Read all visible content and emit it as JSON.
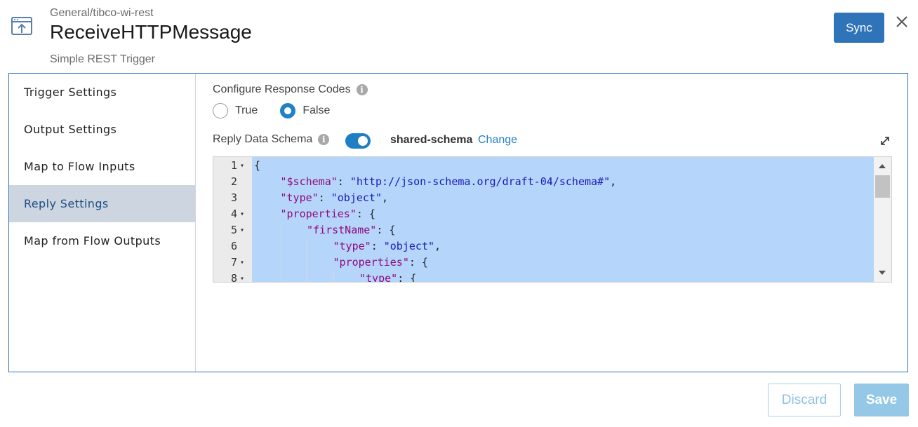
{
  "header": {
    "breadcrumb": "General/tibco-wi-rest",
    "title": "ReceiveHTTPMessage",
    "subtitle": "Simple REST Trigger",
    "icon": "trigger-upload-icon",
    "sync_label": "Sync",
    "close_icon": "close-icon",
    "accent_color": "#2f73b9"
  },
  "sidebar": {
    "items": [
      {
        "label": "Trigger Settings",
        "active": false
      },
      {
        "label": "Output Settings",
        "active": false
      },
      {
        "label": "Map to Flow Inputs",
        "active": false
      },
      {
        "label": "Reply Settings",
        "active": true
      },
      {
        "label": "Map from Flow Outputs",
        "active": false
      }
    ]
  },
  "settings": {
    "response_codes_label": "Configure Response Codes",
    "radio_true": "True",
    "radio_false": "False",
    "selected": "False",
    "reply_schema_label": "Reply Data Schema",
    "toggle_on": true,
    "schema_name": "shared-schema",
    "change_label": "Change"
  },
  "editor": {
    "lines": [
      {
        "n": "1",
        "fold": true,
        "depth": 0,
        "tokens": [
          [
            "p",
            "{"
          ]
        ]
      },
      {
        "n": "2",
        "fold": false,
        "depth": 1,
        "tokens": [
          [
            "k",
            "\"$schema\""
          ],
          [
            "p",
            ": "
          ],
          [
            "s",
            "\"http://json-schema.org/draft-04/schema#\""
          ],
          [
            "p",
            ","
          ]
        ]
      },
      {
        "n": "3",
        "fold": false,
        "depth": 1,
        "tokens": [
          [
            "k",
            "\"type\""
          ],
          [
            "p",
            ": "
          ],
          [
            "s",
            "\"object\""
          ],
          [
            "p",
            ","
          ]
        ]
      },
      {
        "n": "4",
        "fold": true,
        "depth": 1,
        "tokens": [
          [
            "k",
            "\"properties\""
          ],
          [
            "p",
            ": {"
          ]
        ]
      },
      {
        "n": "5",
        "fold": true,
        "depth": 2,
        "tokens": [
          [
            "k",
            "\"firstName\""
          ],
          [
            "p",
            ": {"
          ]
        ]
      },
      {
        "n": "6",
        "fold": false,
        "depth": 3,
        "tokens": [
          [
            "k",
            "\"type\""
          ],
          [
            "p",
            ": "
          ],
          [
            "s",
            "\"object\""
          ],
          [
            "p",
            ","
          ]
        ]
      },
      {
        "n": "7",
        "fold": true,
        "depth": 3,
        "tokens": [
          [
            "k",
            "\"properties\""
          ],
          [
            "p",
            ": {"
          ]
        ]
      },
      {
        "n": "8",
        "fold": true,
        "depth": 4,
        "tokens": [
          [
            "k",
            "\"type\""
          ],
          [
            "p",
            ": {"
          ]
        ]
      }
    ]
  },
  "footer": {
    "discard_label": "Discard",
    "save_label": "Save"
  }
}
